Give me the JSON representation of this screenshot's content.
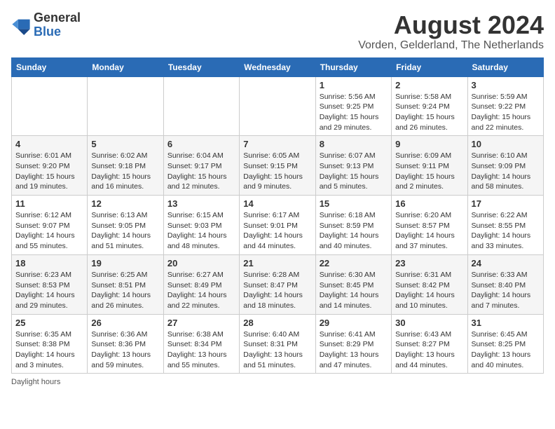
{
  "logo": {
    "general": "General",
    "blue": "Blue"
  },
  "title": "August 2024",
  "subtitle": "Vorden, Gelderland, The Netherlands",
  "days_of_week": [
    "Sunday",
    "Monday",
    "Tuesday",
    "Wednesday",
    "Thursday",
    "Friday",
    "Saturday"
  ],
  "footer": "Daylight hours",
  "weeks": [
    [
      {
        "day": "",
        "info": ""
      },
      {
        "day": "",
        "info": ""
      },
      {
        "day": "",
        "info": ""
      },
      {
        "day": "",
        "info": ""
      },
      {
        "day": "1",
        "info": "Sunrise: 5:56 AM\nSunset: 9:25 PM\nDaylight: 15 hours\nand 29 minutes."
      },
      {
        "day": "2",
        "info": "Sunrise: 5:58 AM\nSunset: 9:24 PM\nDaylight: 15 hours\nand 26 minutes."
      },
      {
        "day": "3",
        "info": "Sunrise: 5:59 AM\nSunset: 9:22 PM\nDaylight: 15 hours\nand 22 minutes."
      }
    ],
    [
      {
        "day": "4",
        "info": "Sunrise: 6:01 AM\nSunset: 9:20 PM\nDaylight: 15 hours\nand 19 minutes."
      },
      {
        "day": "5",
        "info": "Sunrise: 6:02 AM\nSunset: 9:18 PM\nDaylight: 15 hours\nand 16 minutes."
      },
      {
        "day": "6",
        "info": "Sunrise: 6:04 AM\nSunset: 9:17 PM\nDaylight: 15 hours\nand 12 minutes."
      },
      {
        "day": "7",
        "info": "Sunrise: 6:05 AM\nSunset: 9:15 PM\nDaylight: 15 hours\nand 9 minutes."
      },
      {
        "day": "8",
        "info": "Sunrise: 6:07 AM\nSunset: 9:13 PM\nDaylight: 15 hours\nand 5 minutes."
      },
      {
        "day": "9",
        "info": "Sunrise: 6:09 AM\nSunset: 9:11 PM\nDaylight: 15 hours\nand 2 minutes."
      },
      {
        "day": "10",
        "info": "Sunrise: 6:10 AM\nSunset: 9:09 PM\nDaylight: 14 hours\nand 58 minutes."
      }
    ],
    [
      {
        "day": "11",
        "info": "Sunrise: 6:12 AM\nSunset: 9:07 PM\nDaylight: 14 hours\nand 55 minutes."
      },
      {
        "day": "12",
        "info": "Sunrise: 6:13 AM\nSunset: 9:05 PM\nDaylight: 14 hours\nand 51 minutes."
      },
      {
        "day": "13",
        "info": "Sunrise: 6:15 AM\nSunset: 9:03 PM\nDaylight: 14 hours\nand 48 minutes."
      },
      {
        "day": "14",
        "info": "Sunrise: 6:17 AM\nSunset: 9:01 PM\nDaylight: 14 hours\nand 44 minutes."
      },
      {
        "day": "15",
        "info": "Sunrise: 6:18 AM\nSunset: 8:59 PM\nDaylight: 14 hours\nand 40 minutes."
      },
      {
        "day": "16",
        "info": "Sunrise: 6:20 AM\nSunset: 8:57 PM\nDaylight: 14 hours\nand 37 minutes."
      },
      {
        "day": "17",
        "info": "Sunrise: 6:22 AM\nSunset: 8:55 PM\nDaylight: 14 hours\nand 33 minutes."
      }
    ],
    [
      {
        "day": "18",
        "info": "Sunrise: 6:23 AM\nSunset: 8:53 PM\nDaylight: 14 hours\nand 29 minutes."
      },
      {
        "day": "19",
        "info": "Sunrise: 6:25 AM\nSunset: 8:51 PM\nDaylight: 14 hours\nand 26 minutes."
      },
      {
        "day": "20",
        "info": "Sunrise: 6:27 AM\nSunset: 8:49 PM\nDaylight: 14 hours\nand 22 minutes."
      },
      {
        "day": "21",
        "info": "Sunrise: 6:28 AM\nSunset: 8:47 PM\nDaylight: 14 hours\nand 18 minutes."
      },
      {
        "day": "22",
        "info": "Sunrise: 6:30 AM\nSunset: 8:45 PM\nDaylight: 14 hours\nand 14 minutes."
      },
      {
        "day": "23",
        "info": "Sunrise: 6:31 AM\nSunset: 8:42 PM\nDaylight: 14 hours\nand 10 minutes."
      },
      {
        "day": "24",
        "info": "Sunrise: 6:33 AM\nSunset: 8:40 PM\nDaylight: 14 hours\nand 7 minutes."
      }
    ],
    [
      {
        "day": "25",
        "info": "Sunrise: 6:35 AM\nSunset: 8:38 PM\nDaylight: 14 hours\nand 3 minutes."
      },
      {
        "day": "26",
        "info": "Sunrise: 6:36 AM\nSunset: 8:36 PM\nDaylight: 13 hours\nand 59 minutes."
      },
      {
        "day": "27",
        "info": "Sunrise: 6:38 AM\nSunset: 8:34 PM\nDaylight: 13 hours\nand 55 minutes."
      },
      {
        "day": "28",
        "info": "Sunrise: 6:40 AM\nSunset: 8:31 PM\nDaylight: 13 hours\nand 51 minutes."
      },
      {
        "day": "29",
        "info": "Sunrise: 6:41 AM\nSunset: 8:29 PM\nDaylight: 13 hours\nand 47 minutes."
      },
      {
        "day": "30",
        "info": "Sunrise: 6:43 AM\nSunset: 8:27 PM\nDaylight: 13 hours\nand 44 minutes."
      },
      {
        "day": "31",
        "info": "Sunrise: 6:45 AM\nSunset: 8:25 PM\nDaylight: 13 hours\nand 40 minutes."
      }
    ]
  ]
}
